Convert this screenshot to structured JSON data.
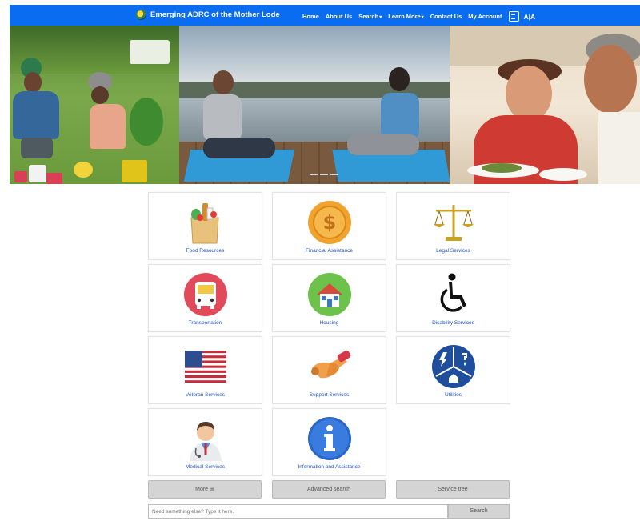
{
  "header": {
    "brand": "Emerging ADRC of the Mother Lode",
    "nav": [
      {
        "label": "Home",
        "dropdown": false
      },
      {
        "label": "About Us",
        "dropdown": false
      },
      {
        "label": "Search",
        "dropdown": true
      },
      {
        "label": "Learn More",
        "dropdown": true
      },
      {
        "label": "Contact Us",
        "dropdown": false
      },
      {
        "label": "My Account",
        "dropdown": false
      }
    ],
    "font_size_label": "A|A",
    "background_color": "#0a6cf0"
  },
  "carousel": {
    "slide_count": 3
  },
  "tiles": [
    {
      "label": "Food Resources",
      "icon": "grocery-bag-icon"
    },
    {
      "label": "Financial Assistance",
      "icon": "dollar-coin-icon"
    },
    {
      "label": "Legal Services",
      "icon": "scales-of-justice-icon"
    },
    {
      "label": "Transportation",
      "icon": "bus-icon"
    },
    {
      "label": "Housing",
      "icon": "house-icon"
    },
    {
      "label": "Disability Services",
      "icon": "wheelchair-icon"
    },
    {
      "label": "Veteran Services",
      "icon": "us-flag-icon"
    },
    {
      "label": "Support Services",
      "icon": "handshake-icon"
    },
    {
      "label": "Utilities",
      "icon": "utilities-icon"
    },
    {
      "label": "Medical Services",
      "icon": "doctor-icon"
    },
    {
      "label": "Information and Assistance",
      "icon": "info-icon"
    }
  ],
  "buttons": {
    "more": "More ⊞",
    "advanced_search": "Advanced search",
    "service_tree": "Service tree"
  },
  "search": {
    "placeholder": "Need something else? Type it here.",
    "button": "Search"
  }
}
